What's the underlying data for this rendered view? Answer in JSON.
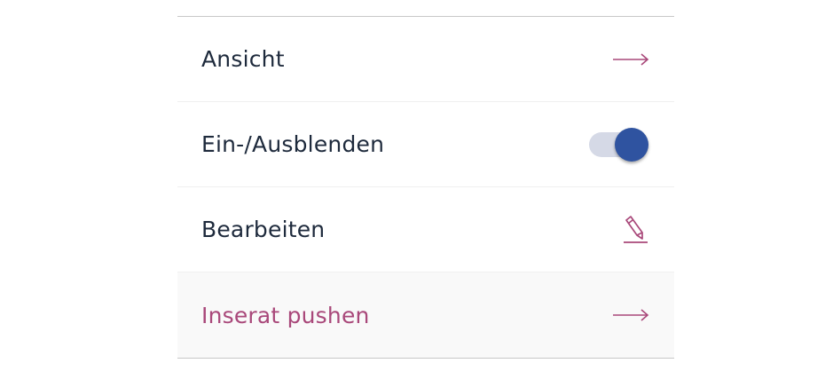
{
  "menu": {
    "items": [
      {
        "label": "Ansicht",
        "icon": "arrow-right-icon"
      },
      {
        "label": "Ein-/Ausblenden",
        "icon": "toggle-switch",
        "toggle_on": true
      },
      {
        "label": "Bearbeiten",
        "icon": "pencil-edit-icon"
      },
      {
        "label": "Inserat pushen",
        "icon": "arrow-right-icon"
      }
    ]
  },
  "colors": {
    "text": "#1e2a3c",
    "accent": "#a9487a",
    "toggle_knob": "#2f53a0",
    "toggle_track": "#d5d9e6",
    "divider": "#c8c8c8",
    "highlight_bg": "#f9f9f9"
  }
}
